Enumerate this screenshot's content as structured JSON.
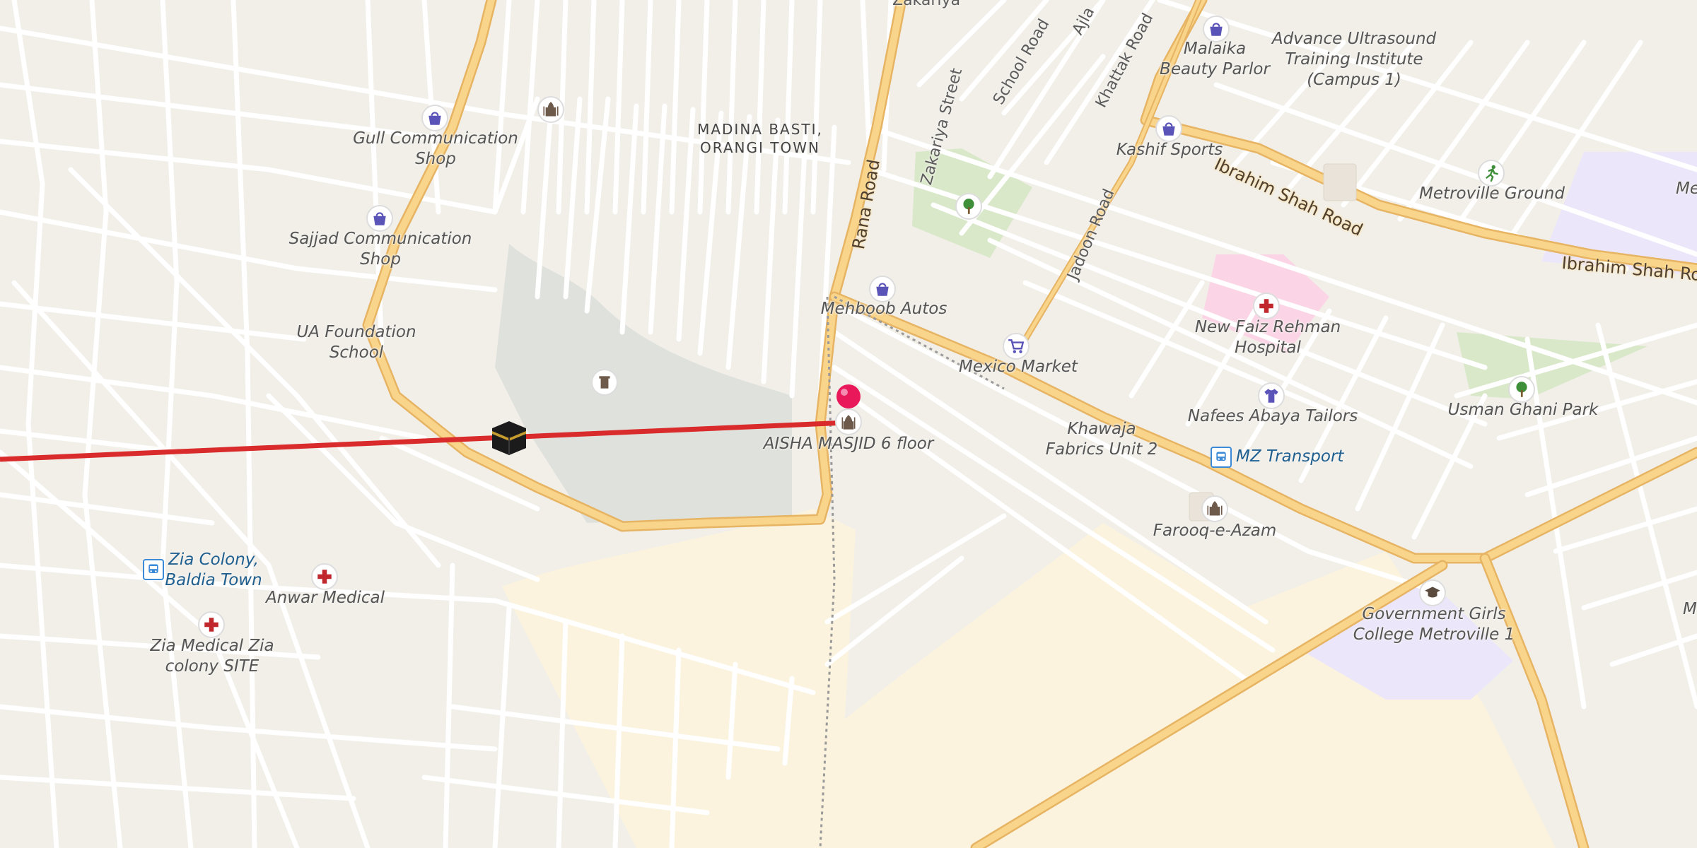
{
  "map": {
    "area_labels": [
      {
        "line1": "MADINA BASTI,",
        "line2": "ORANGI TOWN"
      }
    ],
    "street_labels": {
      "zakariya": "Zakariya",
      "zakariya_street": "Zakariya Street",
      "school_road": "School Road",
      "ajla": "Ajla",
      "khattak_road": "Khattak Road",
      "rana_road": "Rana Road",
      "jadoon_road": "Jadoon Road",
      "ibrahim_shah_road_1": "Ibrahim Shah Road",
      "ibrahim_shah_road_2": "Ibrahim Shah Ro"
    },
    "poi_labels": {
      "gull": [
        "Gull Communication",
        "Shop"
      ],
      "sajjad": [
        "Sajjad Communication",
        "Shop"
      ],
      "ua": [
        "UA Foundation",
        "School"
      ],
      "malaika": [
        "Malaika",
        "Beauty Parlor"
      ],
      "advance": [
        "Advance Ultrasound",
        "Training Institute",
        "(Campus 1)"
      ],
      "kashif": [
        "Kashif Sports"
      ],
      "metroville_ground": [
        "Metroville Ground"
      ],
      "me": [
        "Me"
      ],
      "mehboob": [
        "Mehboob Autos"
      ],
      "mexico": [
        "Mexico Market"
      ],
      "new_faiz": [
        "New Faiz Rehman",
        "Hospital"
      ],
      "usman": [
        "Usman Ghani Park"
      ],
      "nafees": [
        "Nafees Abaya Tailors"
      ],
      "aisha": [
        "AISHA MASJID 6 floor"
      ],
      "khawaja": [
        "Khawaja",
        "Fabrics Unit 2"
      ],
      "mz": [
        "MZ Transport"
      ],
      "farooq": [
        "Farooq-e-Azam"
      ],
      "zia_colony": [
        "Zia Colony,",
        "Baldia Town"
      ],
      "anwar": [
        "Anwar Medical"
      ],
      "zia_medical": [
        "Zia Medical Zia",
        "colony SITE"
      ],
      "govt_girls": [
        "Government Girls",
        "College Metroville 1"
      ],
      "m_edge": [
        "M"
      ]
    },
    "colors": {
      "background": "#f2efe9",
      "road_major": "#f9d58b",
      "road_major_casing": "#e6b463",
      "road_minor": "#ffffff",
      "park": "#d8e8c8",
      "hospital_area": "#fbd5e6",
      "education_area": "#ece6fb",
      "cemetery": "#dfe1dc",
      "sand": "#fbf3dd",
      "qibla_line": "#d92b2b",
      "pin": "#e8185a",
      "shop_icon": "#5b54b8",
      "health_icon": "#c0282d",
      "park_icon": "#3f8f3a",
      "religion_icon": "#6e5a4b"
    }
  }
}
